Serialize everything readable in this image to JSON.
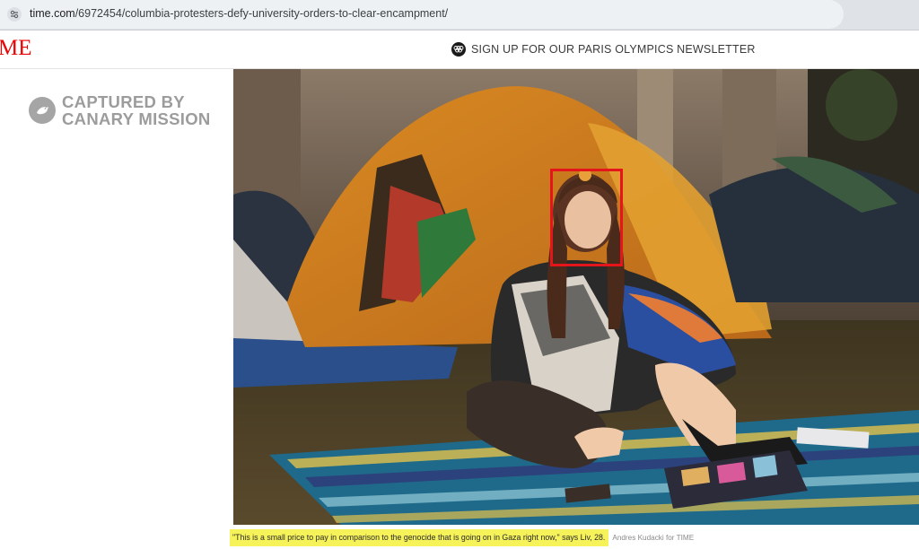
{
  "browser": {
    "url_host": "time.com",
    "url_path": "/6972454/columbia-protesters-defy-university-orders-to-clear-encampment/",
    "site_settings_icon": "tune-icon"
  },
  "header": {
    "logo_text": "ME",
    "logo_color": "#e90606",
    "newsletter_icon": "olympics-rings-icon",
    "newsletter_label": "SIGN UP FOR OUR PARIS OLYMPICS NEWSLETTER"
  },
  "watermark": {
    "line1": "CAPTURED BY",
    "line2": "CANARY MISSION",
    "icon": "canary-bird-icon"
  },
  "photo": {
    "highlight_color": "#e5161b"
  },
  "caption": {
    "quote": "\"This is a small price to pay in comparison to the genocide that is going on in Gaza right now,\" says Liv, 28.",
    "credit": "Andres Kudacki for TIME",
    "highlight_color": "#f6f25a"
  }
}
